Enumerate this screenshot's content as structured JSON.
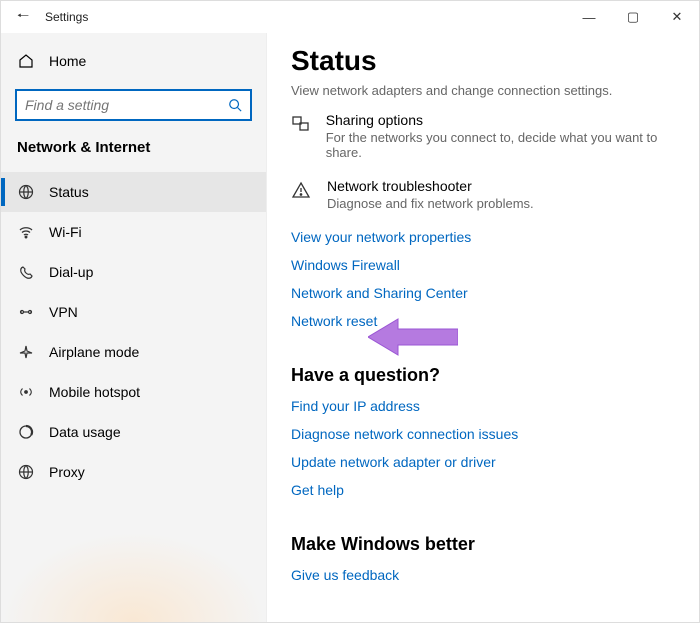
{
  "titlebar": {
    "title": "Settings"
  },
  "sidebar": {
    "home": "Home",
    "search_placeholder": "Find a setting",
    "category": "Network & Internet",
    "items": [
      {
        "label": "Status"
      },
      {
        "label": "Wi-Fi"
      },
      {
        "label": "Dial-up"
      },
      {
        "label": "VPN"
      },
      {
        "label": "Airplane mode"
      },
      {
        "label": "Mobile hotspot"
      },
      {
        "label": "Data usage"
      },
      {
        "label": "Proxy"
      }
    ]
  },
  "content": {
    "title": "Status",
    "cutoff": "View network adapters and change connection settings.",
    "sharing": {
      "label": "Sharing options",
      "desc": "For the networks you connect to, decide what you want to share."
    },
    "troubleshoot": {
      "label": "Network troubleshooter",
      "desc": "Diagnose and fix network problems."
    },
    "links": {
      "properties": "View your network properties",
      "firewall": "Windows Firewall",
      "sharing_center": "Network and Sharing Center",
      "reset": "Network reset"
    },
    "question": {
      "title": "Have a question?",
      "ip": "Find your IP address",
      "diagnose": "Diagnose network connection issues",
      "update": "Update network adapter or driver",
      "help": "Get help"
    },
    "better": {
      "title": "Make Windows better",
      "feedback": "Give us feedback"
    }
  }
}
